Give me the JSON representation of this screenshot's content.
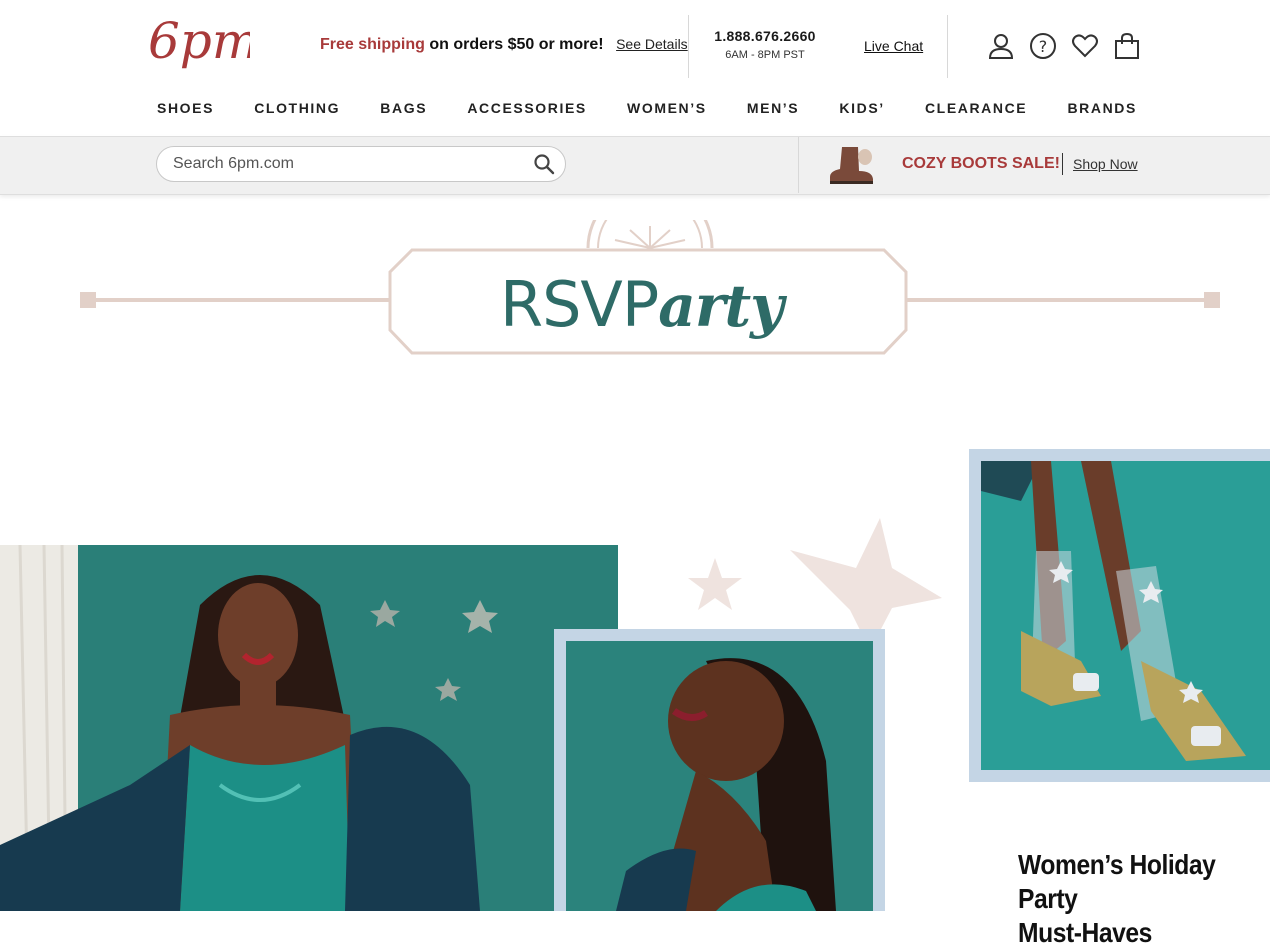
{
  "header": {
    "logo_text": "6pm",
    "promo": {
      "highlight": "Free shipping",
      "rest": "on orders $50 or more!",
      "link": "See Details"
    },
    "phone": {
      "number": "1.888.676.2660",
      "hours": "6AM - 8PM PST"
    },
    "live_chat": "Live Chat",
    "icons": [
      "account-icon",
      "help-icon",
      "favorites-heart-icon",
      "shopping-bag-icon"
    ]
  },
  "nav": {
    "items": [
      "SHOES",
      "CLOTHING",
      "BAGS",
      "ACCESSORIES",
      "WOMEN’S",
      "MEN’S",
      "KIDS’",
      "CLEARANCE",
      "BRANDS"
    ]
  },
  "search": {
    "placeholder": "Search 6pm.com"
  },
  "sale_banner": {
    "title": "COZY BOOTS SALE!",
    "link": "Shop Now"
  },
  "hero": {
    "title_plain": "RSVP",
    "title_italic": "arty"
  },
  "feature": {
    "caption_line1": "Women’s Holiday Party",
    "caption_line2": "Must-Haves"
  },
  "colors": {
    "brand_red": "#a83a3a",
    "teal": "#2e6b67",
    "frame_blue": "#c4d5e5",
    "banner_pink": "#e2d0c8"
  }
}
